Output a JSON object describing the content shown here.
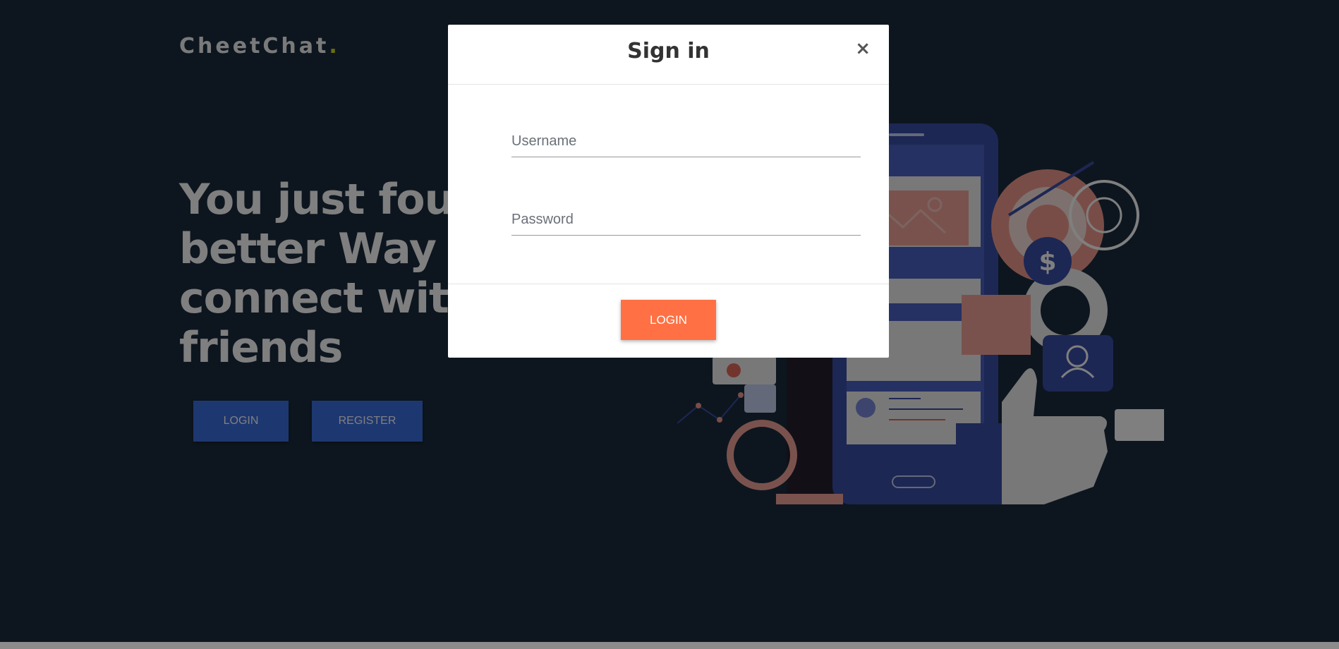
{
  "brand": {
    "name": "CheetChat",
    "dot": "."
  },
  "hero": {
    "lines": [
      "You just found a",
      "better Way to",
      "connect with",
      "friends"
    ],
    "login_label": "LOGIN",
    "register_label": "REGISTER"
  },
  "modal": {
    "title": "Sign in",
    "close_label": "×",
    "username_placeholder": "Username",
    "password_placeholder": "Password",
    "submit_label": "LOGIN"
  },
  "colors": {
    "background": "#1b2c3e",
    "brand_dot": "#d7e022",
    "hero_button": "#3b6fe0",
    "modal_submit": "#ff7144"
  },
  "icons": [
    "close-icon",
    "dollar-icon",
    "user-icon",
    "gear-icon",
    "target-icon",
    "thumbs-up-icon"
  ]
}
